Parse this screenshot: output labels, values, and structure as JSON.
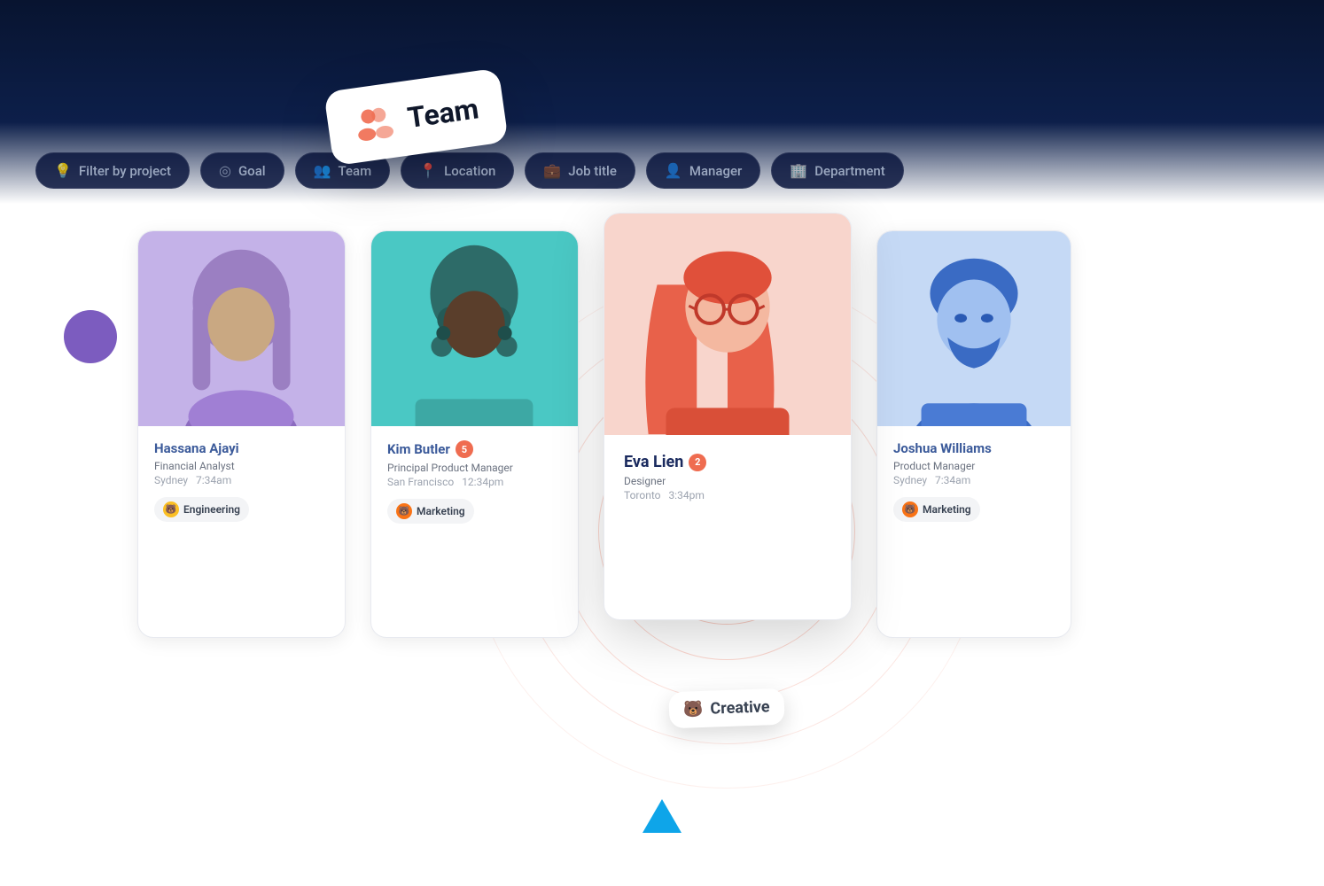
{
  "filters": [
    {
      "id": "filter-project",
      "label": "Filter by project",
      "icon": "💡"
    },
    {
      "id": "filter-goal",
      "label": "Goal",
      "icon": "◎"
    },
    {
      "id": "filter-team",
      "label": "Team",
      "icon": "👥"
    },
    {
      "id": "filter-location",
      "label": "Location",
      "icon": "📍"
    },
    {
      "id": "filter-jobtitle",
      "label": "Job title",
      "icon": "💼"
    },
    {
      "id": "filter-manager",
      "label": "Manager",
      "icon": "👤"
    },
    {
      "id": "filter-department",
      "label": "Department",
      "icon": "🏢"
    }
  ],
  "team_label": "Team",
  "people": [
    {
      "id": "hassana",
      "name": "Hassana Ajayi",
      "title": "Financial Analyst",
      "location": "Sydney",
      "time": "7:34am",
      "team": "Engineering",
      "badge_num": null,
      "highlighted": false
    },
    {
      "id": "kim",
      "name": "Kim Butler",
      "title": "Principal Product Manager",
      "location": "San Francisco",
      "time": "12:34pm",
      "team": "Marketing",
      "badge_num": 5,
      "highlighted": false
    },
    {
      "id": "eva",
      "name": "Eva Lien",
      "title": "Designer",
      "location": "Toronto",
      "time": "3:34pm",
      "team": "Creative",
      "badge_num": 2,
      "highlighted": true
    },
    {
      "id": "joshua",
      "name": "Joshua Williams",
      "title": "Product Manager",
      "location": "Sydney",
      "time": "7:34am",
      "team": "Marketing",
      "badge_num": null,
      "highlighted": false
    }
  ],
  "creative_badge": "Creative",
  "colors": {
    "accent_blue": "#0ea5e9",
    "accent_orange": "#ef6c50",
    "purple": "#7c5cbf",
    "name_blue": "#3b5a9a"
  }
}
